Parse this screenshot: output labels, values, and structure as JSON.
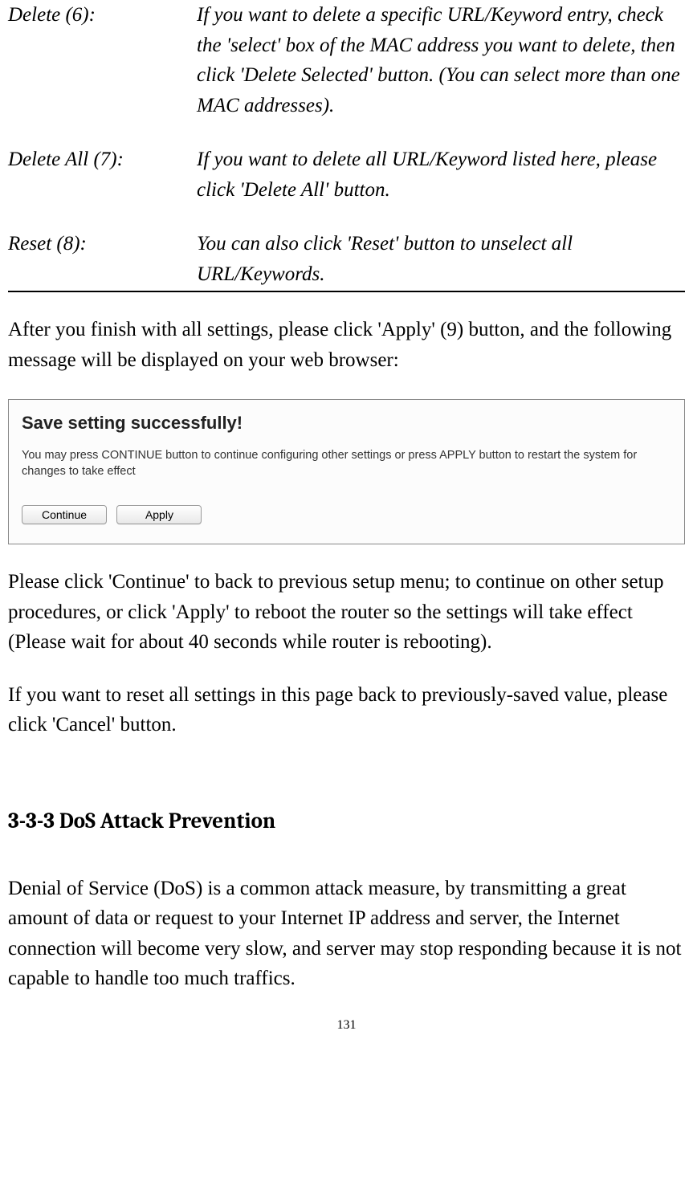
{
  "definitions": [
    {
      "label": "Delete (6):",
      "text": "If you want to delete a specific URL/Keyword entry, check the 'select' box of the MAC address you want to delete, then click 'Delete Selected' button. (You can select more than one MAC addresses)."
    },
    {
      "label": "Delete All (7):",
      "text": "If you want to delete all URL/Keyword listed here, please click 'Delete All' button."
    },
    {
      "label": "Reset (8):",
      "text": "You can also click 'Reset' button to unselect all URL/Keywords."
    }
  ],
  "para_after_defs": "After you finish with all settings, please click 'Apply' (9) button, and the following message will be displayed on your web browser:",
  "screenshot": {
    "title": "Save setting successfully!",
    "text": "You may press CONTINUE button to continue configuring other settings or press APPLY button to restart the system for changes to take effect",
    "continue_label": "Continue",
    "apply_label": "Apply"
  },
  "para_continue": "Please click 'Continue' to back to previous setup menu; to continue on other setup procedures, or click 'Apply' to reboot the router so the settings will take effect (Please wait for about 40 seconds while router is rebooting).",
  "para_cancel": "If you want to reset all settings in this page back to previously-saved value, please click 'Cancel' button.",
  "section_heading": "3-3-3 DoS Attack Prevention",
  "para_dos": "Denial of Service (DoS) is a common attack measure, by transmitting a great amount of data or request to your Internet IP address and server, the Internet connection will become very slow, and server may stop responding because it is not capable to handle too much traffics.",
  "page_number": "131"
}
